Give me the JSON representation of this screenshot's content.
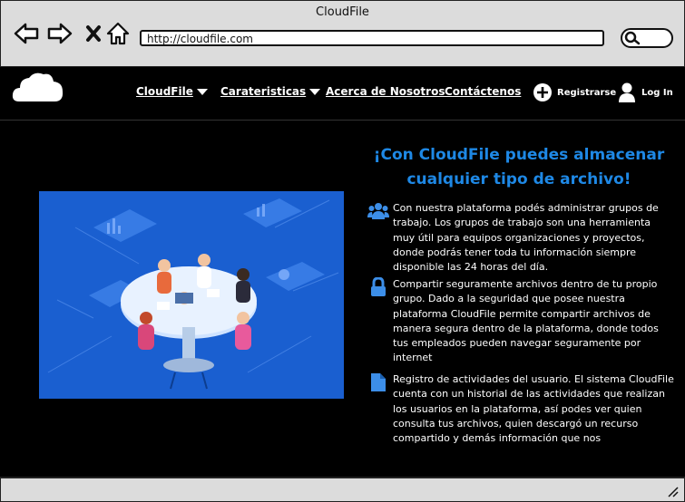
{
  "window": {
    "title": "CloudFile"
  },
  "browser": {
    "url": "http://cloudfile.com"
  },
  "site": {
    "logo_text": "CloudFile",
    "nav": [
      {
        "label": "CloudFile"
      },
      {
        "label": "Carateristicas"
      },
      {
        "label": "Acerca de Nosotros"
      },
      {
        "label": "Contáctenos"
      }
    ],
    "register_label": "Registrarse",
    "login_label": "Log In",
    "headline": "¡Con CloudFile puedes almacenar cualquier tipo de archivo!",
    "features": [
      {
        "icon": "group-icon",
        "text": "Con nuestra plataforma podés administrar grupos de trabajo. Los grupos de trabajo son una herramienta muy útil para equipos organizaciones y proyectos, donde podrás tener toda tu información siempre disponible las 24 horas del día."
      },
      {
        "icon": "lock-icon",
        "text": "Compartir seguramente archivos dentro de tu propio grupo. Dado a la seguridad que posee nuestra plataforma CloudFile permite compartir archivos de manera segura dentro de la plataforma, donde todos tus empleados pueden navegar seguramente por internet"
      },
      {
        "icon": "file-icon",
        "text": "Registro de actividades del usuario. El sistema CloudFile cuenta con un historial de las actividades que realizan los usuarios en la plataforma, así podes ver quien consulta tus archivos, quien descargó un recurso compartido y demás información que nos"
      }
    ]
  },
  "colors": {
    "accent": "#1e88e5",
    "hero_bg": "#1a5fd0",
    "chrome": "#dcdcdc"
  }
}
